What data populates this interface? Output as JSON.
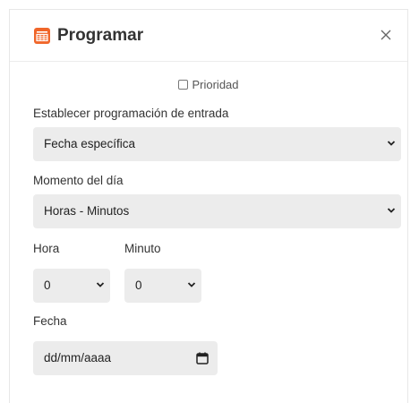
{
  "dialog": {
    "title": "Programar",
    "close_label": "×",
    "accent_color": "#f0662a"
  },
  "priority": {
    "label": "Prioridad",
    "checked": false
  },
  "schedule": {
    "label": "Establecer programación de entrada",
    "selected": "Fecha específica"
  },
  "moment": {
    "label": "Momento del día",
    "selected": "Horas - Minutos"
  },
  "hour": {
    "label": "Hora",
    "selected": "0"
  },
  "minute": {
    "label": "Minuto",
    "selected": "0"
  },
  "date": {
    "label": "Fecha",
    "placeholder": "dd/mm/aaaa"
  },
  "icons": {
    "header": "calendar-icon",
    "close": "close-icon",
    "dropdown": "chevron-down-icon",
    "date_picker": "calendar-icon"
  }
}
